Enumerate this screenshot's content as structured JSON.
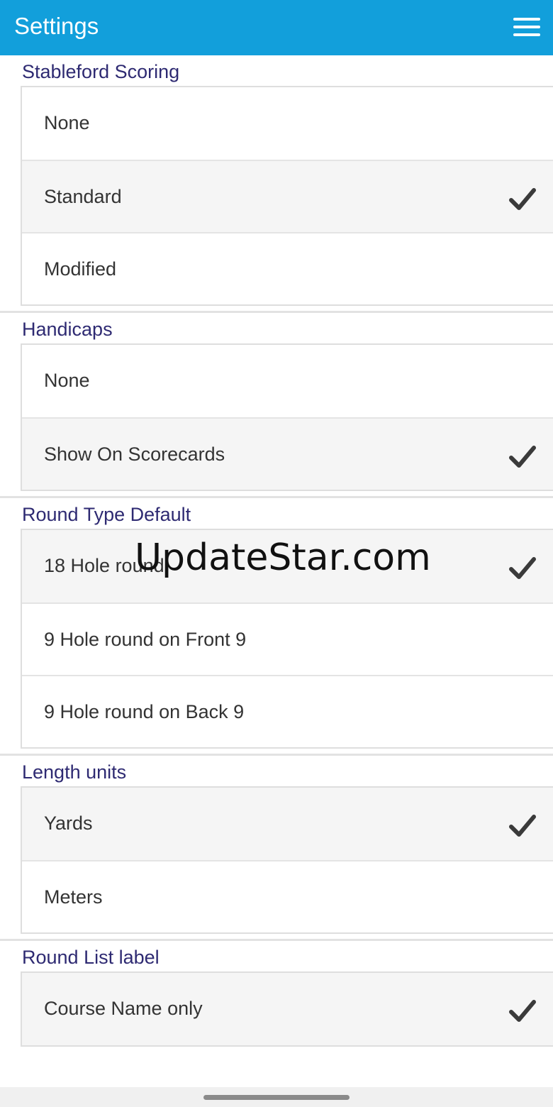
{
  "app_bar": {
    "title": "Settings",
    "menu_icon": "hamburger-menu-icon",
    "background_color": "#129fdb"
  },
  "sections": [
    {
      "id": "stableford",
      "header": "Stableford Scoring",
      "options": [
        {
          "label": "None",
          "selected": false
        },
        {
          "label": "Standard",
          "selected": true
        },
        {
          "label": "Modified",
          "selected": false
        }
      ]
    },
    {
      "id": "handicaps",
      "header": "Handicaps",
      "options": [
        {
          "label": "None",
          "selected": false
        },
        {
          "label": "Show On Scorecards",
          "selected": true
        }
      ]
    },
    {
      "id": "round-type",
      "header": "Round Type Default",
      "options": [
        {
          "label": "18 Hole round",
          "selected": true
        },
        {
          "label": "9 Hole round on Front 9",
          "selected": false
        },
        {
          "label": "9 Hole round on Back 9",
          "selected": false
        }
      ]
    },
    {
      "id": "length-units",
      "header": "Length units",
      "options": [
        {
          "label": "Yards",
          "selected": true
        },
        {
          "label": "Meters",
          "selected": false
        }
      ]
    },
    {
      "id": "round-list-label",
      "header": "Round List label",
      "options": [
        {
          "label": "Course Name only",
          "selected": true
        }
      ]
    }
  ],
  "check_icon": "checkmark-icon",
  "header_color": "#2e2a72",
  "watermark": "UpdateStar.com"
}
